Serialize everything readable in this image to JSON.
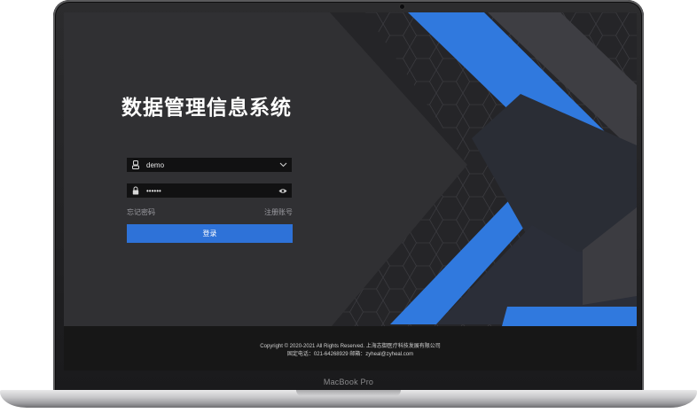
{
  "device": {
    "model_label": "MacBook Pro"
  },
  "login": {
    "app_title": "数据管理信息系统",
    "username": {
      "value": "demo"
    },
    "password": {
      "value": "••••••"
    },
    "forgot_password": "忘记密码",
    "register": "注册账号",
    "submit": "登录"
  },
  "footer": {
    "copyright": "Copyright © 2020-2021 All Rights Reserved. 上海志御医疗科技发展有限公司",
    "contact": "固定电话：021-64268929 邮箱：zyheal@zyheal.com"
  },
  "colors": {
    "accent_blue": "#2e72d8",
    "background": "#2f2f32",
    "footer_bg": "#171717",
    "field_bg": "#111112"
  },
  "icons": [
    "user-icon",
    "chevron-down-icon",
    "lock-icon",
    "eye-icon"
  ]
}
